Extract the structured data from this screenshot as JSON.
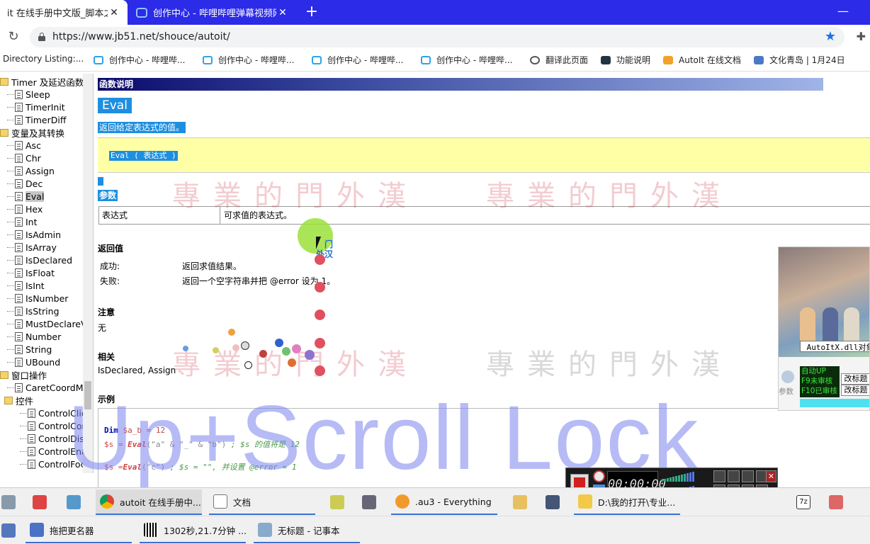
{
  "browser": {
    "tabs": [
      {
        "title": "it 在线手册中文版_脚本之家",
        "close": "✕"
      },
      {
        "title": "创作中心 - 哔哩哔哩弹幕视频网",
        "close": "✕"
      }
    ],
    "new_tab": "+",
    "minimize": "—",
    "reload": "↻",
    "url": "https://www.jb51.net/shouce/autoit/",
    "star": "★",
    "extension": "✚"
  },
  "bookmarks": [
    {
      "label": "Directory Listing:...",
      "icon": "none"
    },
    {
      "label": "创作中心 - 哔哩哔...",
      "icon": "bilibili-icon"
    },
    {
      "label": "创作中心 - 哔哩哔...",
      "icon": "bilibili-icon"
    },
    {
      "label": "创作中心 - 哔哩哔...",
      "icon": "bilibili-icon"
    },
    {
      "label": "创作中心 - 哔哩哔...",
      "icon": "bilibili-icon"
    },
    {
      "label": "翻译此页面",
      "icon": "globe-icon"
    },
    {
      "label": "功能说明",
      "icon": "app-icon"
    },
    {
      "label": "AutoIt 在线文档",
      "icon": "autoit-icon"
    },
    {
      "label": "文化青岛 | 1月24日",
      "icon": "news-icon"
    }
  ],
  "tree": {
    "items": [
      {
        "label": "Timer 及延迟函数",
        "kind": "folder"
      },
      {
        "label": "Sleep",
        "kind": "doc"
      },
      {
        "label": "TimerInit",
        "kind": "doc"
      },
      {
        "label": "TimerDiff",
        "kind": "doc"
      },
      {
        "label": "变量及其转换",
        "kind": "folder"
      },
      {
        "label": "Asc",
        "kind": "doc"
      },
      {
        "label": "Chr",
        "kind": "doc"
      },
      {
        "label": "Assign",
        "kind": "doc"
      },
      {
        "label": "Dec",
        "kind": "doc"
      },
      {
        "label": "Eval",
        "kind": "doc",
        "selected": true
      },
      {
        "label": "Hex",
        "kind": "doc"
      },
      {
        "label": "Int",
        "kind": "doc"
      },
      {
        "label": "IsAdmin",
        "kind": "doc"
      },
      {
        "label": "IsArray",
        "kind": "doc"
      },
      {
        "label": "IsDeclared",
        "kind": "doc"
      },
      {
        "label": "IsFloat",
        "kind": "doc"
      },
      {
        "label": "IsInt",
        "kind": "doc"
      },
      {
        "label": "IsNumber",
        "kind": "doc"
      },
      {
        "label": "IsString",
        "kind": "doc"
      },
      {
        "label": "MustDeclareV",
        "kind": "doc"
      },
      {
        "label": "Number",
        "kind": "doc"
      },
      {
        "label": "String",
        "kind": "doc"
      },
      {
        "label": "UBound",
        "kind": "doc"
      },
      {
        "label": "窗口操作",
        "kind": "folder"
      },
      {
        "label": "CaretCoordM",
        "kind": "doc"
      },
      {
        "label": "控件",
        "kind": "folder"
      },
      {
        "label": "ControlClic",
        "kind": "doc2"
      },
      {
        "label": "ControlCor",
        "kind": "doc2"
      },
      {
        "label": "ControlDis",
        "kind": "doc2"
      },
      {
        "label": "ControlEna",
        "kind": "doc2"
      },
      {
        "label": "ControlFoc",
        "kind": "doc2"
      }
    ]
  },
  "doc": {
    "header": "函数说明",
    "func_name": "Eval",
    "func_desc": "返回给定表达式的值。",
    "syntax": "Eval ( 表达式 )",
    "params_title": "参数",
    "param_name": "表达式",
    "param_desc": "可求值的表达式。",
    "return_title": "返回值",
    "success_label": "成功:",
    "success_text": "返回求值结果。",
    "fail_label": "失败:",
    "fail_text": "返回一个空字符串并把 @error 设为 1。",
    "notes_title": "注意",
    "notes_text": "无",
    "related_title": "相关",
    "related_text": "IsDeclared, Assign",
    "example_title": "示例",
    "code": {
      "l1_kw": "Dim",
      "l1_rest": " $a_b = 12",
      "l2_var": "$s",
      "l2_eq": " = ",
      "l2_fn": "Eval",
      "l2_args": "(\"a\" & \"_\" & \"b\")",
      "l2_cmt": "  ; $s 的值将是 12",
      "l3_var": "$s",
      "l3_eq": " =",
      "l3_fn": "Eval",
      "l3_args": "(\"c\")",
      "l3_cmt": "  ; $s = \"\", 并设置 @error = 1"
    },
    "seal_text": "專業的門外漢",
    "cursor_label_1": "门",
    "cursor_label_2": "外汉"
  },
  "watermark": "Up+Scroll Lock",
  "overlay": {
    "caption": "_AutoItX.dll对象",
    "green_lines": [
      "自动UP",
      "F9未审核",
      "F10已审核"
    ],
    "btn1": "改标题",
    "btn2": "改标题",
    "side_text": "参数"
  },
  "recorder": {
    "time": "00:00:00"
  },
  "taskbar": {
    "row1": [
      {
        "label": "",
        "icon": "app"
      },
      {
        "label": "",
        "icon": "app"
      },
      {
        "label": "",
        "icon": "app"
      },
      {
        "label": "autoit 在线手册中...",
        "icon": "chrome"
      },
      {
        "label": "文档",
        "icon": "doc"
      },
      {
        "label": ".au3 - Everything",
        "icon": "search"
      },
      {
        "label": "D:\\我的打开\\专业...",
        "icon": "folder"
      }
    ],
    "row2": [
      {
        "label": "拖把更名器",
        "icon": "app"
      },
      {
        "label": "1302秒,21.7分钟 ...",
        "icon": "barcode"
      },
      {
        "label": "无标题 - 记事本",
        "icon": "notepad"
      }
    ]
  },
  "colors": {
    "tab_strip": "#2b2be8",
    "selection": "#1e8fe0",
    "syntax_bg": "#ffffa6",
    "watermark": "#7c84f0"
  }
}
